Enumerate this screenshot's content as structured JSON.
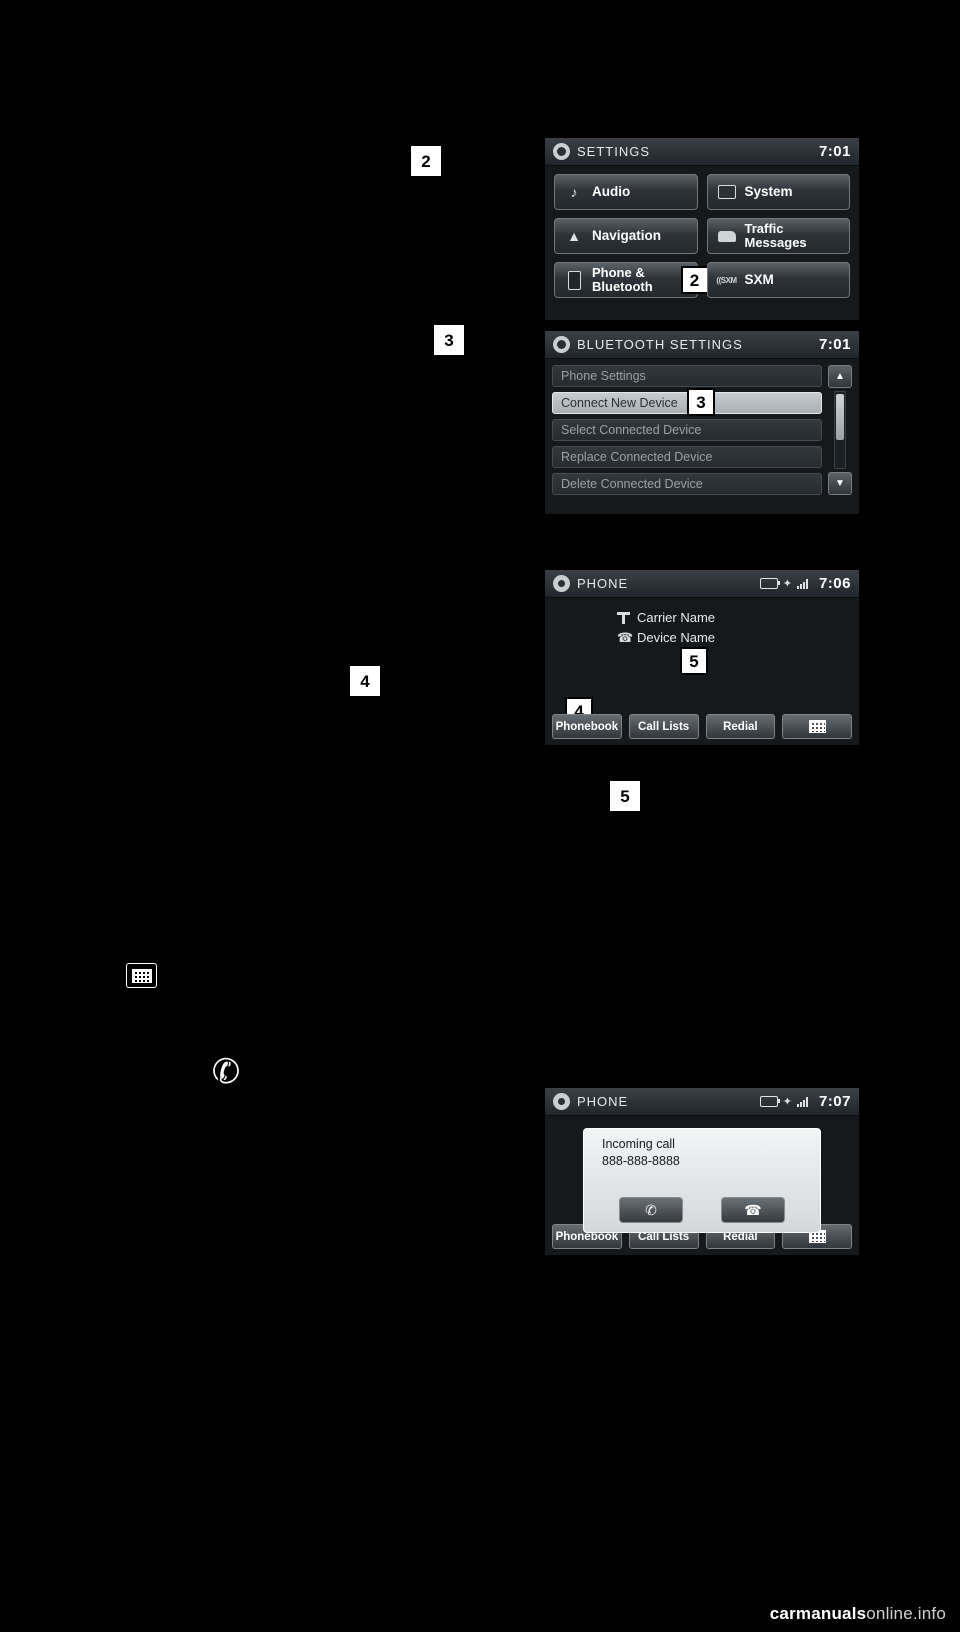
{
  "page": {
    "background": "#000000",
    "watermark_prefix": "carmanuals",
    "watermark_suffix": "online.info"
  },
  "callouts": [
    {
      "id": "callout-2-left",
      "label": "2"
    },
    {
      "id": "callout-3-left",
      "label": "3"
    },
    {
      "id": "callout-4-left",
      "label": "4"
    },
    {
      "id": "callout-5-left",
      "label": "5"
    }
  ],
  "settings_screen": {
    "title": "SETTINGS",
    "time": "7:01",
    "gear_icon": "gear-icon",
    "callout": "2",
    "buttons": [
      {
        "label": "Audio",
        "icon": "music-note-icon"
      },
      {
        "label": "System",
        "icon": "display-icon"
      },
      {
        "label": "Navigation",
        "icon": "navigation-arrow-icon"
      },
      {
        "label": "Traffic Messages",
        "icon": "traffic-car-icon"
      },
      {
        "label": "Phone & Bluetooth",
        "icon": "mobile-phone-icon"
      },
      {
        "label": "SXM",
        "icon": "sxm-logo-icon"
      }
    ]
  },
  "bluetooth_screen": {
    "title": "BLUETOOTH SETTINGS",
    "time": "7:01",
    "gear_icon": "gear-icon",
    "callout": "3",
    "rows": [
      {
        "label": "Phone Settings",
        "selected": false
      },
      {
        "label": "Connect New Device",
        "selected": true
      },
      {
        "label": "Select Connected Device",
        "selected": false
      },
      {
        "label": "Replace Connected Device",
        "selected": false
      },
      {
        "label": "Delete Connected Device",
        "selected": false
      }
    ],
    "scroll_up": "▲",
    "scroll_down": "▼"
  },
  "phone_screen": {
    "title": "PHONE",
    "time": "7:06",
    "phone_icon": "phone-handset-icon",
    "status_icons": [
      "battery-icon",
      "bluetooth-icon",
      "signal-bars-icon"
    ],
    "carrier_label": "Carrier Name",
    "device_label": "Device Name",
    "carrier_icon": "antenna-icon",
    "device_icon": "handset-icon",
    "callout_device": "5",
    "callout_softkeys": "4",
    "softkeys": [
      {
        "label": "Phonebook"
      },
      {
        "label": "Call Lists"
      },
      {
        "label": "Redial"
      },
      {
        "label": "",
        "icon": "keypad-grid-icon"
      }
    ]
  },
  "incoming_call_screen": {
    "title": "PHONE",
    "time": "7:07",
    "phone_icon": "phone-handset-icon",
    "status_icons": [
      "battery-icon",
      "bluetooth-icon",
      "signal-bars-icon"
    ],
    "dialog": {
      "heading": "Incoming call",
      "number": "888-888-8888",
      "accept_icon": "answer-call-icon",
      "reject_icon": "end-call-icon"
    },
    "softkeys": [
      {
        "label": "Phonebook"
      },
      {
        "label": "Call Lists"
      },
      {
        "label": "Redial"
      },
      {
        "label": "",
        "icon": "keypad-grid-icon"
      }
    ]
  },
  "body_glyphs": [
    {
      "name": "keypad-grid-icon"
    },
    {
      "name": "answer-call-icon"
    }
  ]
}
